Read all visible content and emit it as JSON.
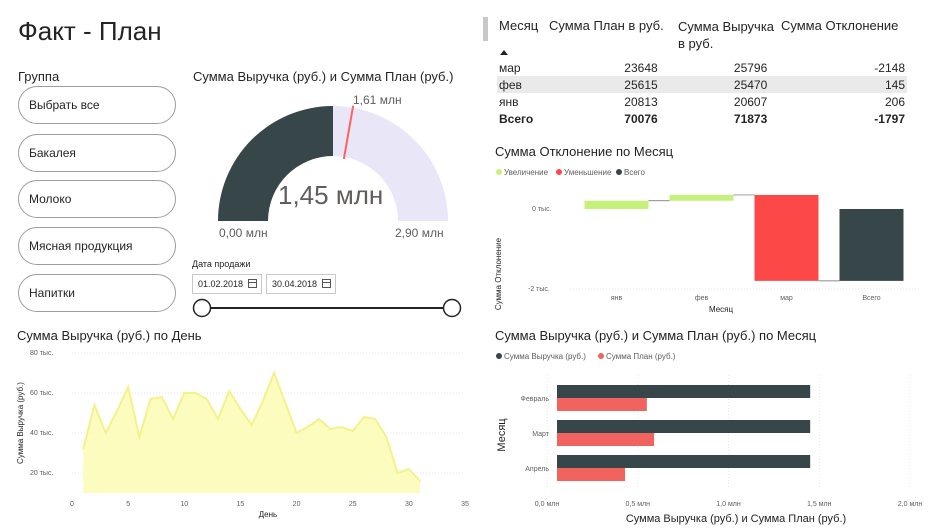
{
  "page_title": "Факт - План",
  "slicer": {
    "label": "Группа",
    "items": [
      "Выбрать все",
      "Бакалея",
      "Молоко",
      "Мясная продукция",
      "Напитки"
    ]
  },
  "gauge": {
    "title": "Сумма Выручка (руб.) и Сумма План (руб.)",
    "value_label": "1,45 млн",
    "target_label": "1,61 млн",
    "min_label": "0,00 млн",
    "max_label": "2,90 млн",
    "value": 1.45,
    "target": 1.61,
    "min": 0,
    "max": 2.9,
    "fill_color": "#374649",
    "track_color": "#e9e7f7",
    "target_color": "#fd625e"
  },
  "date_filter": {
    "label": "Дата продажи",
    "start": "01.02.2018",
    "end": "30.04.2018"
  },
  "matrix": {
    "headers": [
      "Месяц",
      "Сумма План в руб.",
      "Сумма Выручка в руб.",
      "Сумма Отклонение"
    ],
    "rows": [
      [
        "мар",
        "23648",
        "25796",
        "-2148"
      ],
      [
        "фев",
        "25615",
        "25470",
        "145"
      ],
      [
        "янв",
        "20813",
        "20607",
        "206"
      ]
    ],
    "total": [
      "Всего",
      "70076",
      "71873",
      "-1797"
    ]
  },
  "waterfall": {
    "title": "Сумма Отклонение по Месяц",
    "legend": [
      {
        "label": "Увеличение",
        "color": "#c5f07a"
      },
      {
        "label": "Уменьшение",
        "color": "#fd4848"
      },
      {
        "label": "Всего",
        "color": "#374649"
      }
    ],
    "ylabel": "Сумма Отклонение",
    "xlabel": "Месяц",
    "yticks": [
      "0 тыс.",
      "-2 тыс."
    ]
  },
  "line_chart": {
    "title": "Сумма Выручка (руб.) по День",
    "ylabel": "Сумма Выручка (руб.)",
    "xlabel": "День",
    "yticks": [
      "80 тыс.",
      "60 тыс.",
      "40 тыс.",
      "20 тыс."
    ],
    "xticks": [
      "0",
      "5",
      "10",
      "15",
      "20",
      "25",
      "30",
      "35"
    ],
    "fill_color": "#fbfbb4",
    "line_color": "#f4f28a"
  },
  "bar_chart": {
    "title": "Сумма Выручка (руб.) и Сумма План (руб.) по Месяц",
    "legend": [
      {
        "label": "Сумма Выручка (руб.)",
        "color": "#374649"
      },
      {
        "label": "Сумма План (руб.)",
        "color": "#f0635e"
      }
    ],
    "ylabel": "Месяц",
    "xlabel": "Сумма Выручка (руб.) и Сумма План (руб.)",
    "xticks": [
      "0,0 млн",
      "0,5 млн",
      "1,0 млн",
      "1,5 млн",
      "2,0 млн"
    ]
  },
  "chart_data": [
    {
      "type": "line",
      "title": "Сумма Выручка (руб.) по День",
      "xlabel": "День",
      "ylabel": "Сумма Выручка (руб.)",
      "xlim": [
        0,
        35
      ],
      "ylim": [
        10000,
        80000
      ],
      "x": [
        1,
        2,
        3,
        4,
        5,
        6,
        7,
        8,
        9,
        10,
        11,
        12,
        13,
        14,
        15,
        16,
        17,
        18,
        19,
        20,
        21,
        22,
        23,
        24,
        25,
        26,
        27,
        28,
        29,
        30,
        31
      ],
      "series": [
        {
          "values": [
            32000,
            54000,
            40000,
            51000,
            63000,
            38000,
            57000,
            58000,
            47000,
            60000,
            60000,
            57000,
            47000,
            61000,
            52000,
            44000,
            56000,
            70000,
            55000,
            40000,
            43000,
            47000,
            42000,
            43000,
            41000,
            48000,
            47000,
            38000,
            20000,
            22000,
            16000
          ]
        }
      ]
    },
    {
      "type": "bar",
      "title": "Сумма Отклонение по Месяц",
      "xlabel": "Месяц",
      "ylabel": "Сумма Отклонение",
      "categories": [
        "янв",
        "фев",
        "мар",
        "Всего"
      ],
      "values": [
        206,
        145,
        -2148,
        -1797
      ],
      "ylim": [
        -2000,
        0
      ]
    },
    {
      "type": "bar",
      "title": "Сумма Выручка (руб.) и Сумма План (руб.) по Месяц",
      "xlabel": "Сумма Выручка (руб.) и Сумма План (руб.)",
      "ylabel": "Месяц",
      "categories": [
        "Февраль",
        "Март",
        "Апрель"
      ],
      "xlim": [
        0,
        2.0
      ],
      "series": [
        {
          "name": "Сумма Выручка (руб.)",
          "values": [
            1.45,
            1.45,
            1.45
          ]
        },
        {
          "name": "Сумма План (руб.)",
          "values": [
            0.55,
            0.59,
            0.43
          ]
        }
      ]
    }
  ]
}
